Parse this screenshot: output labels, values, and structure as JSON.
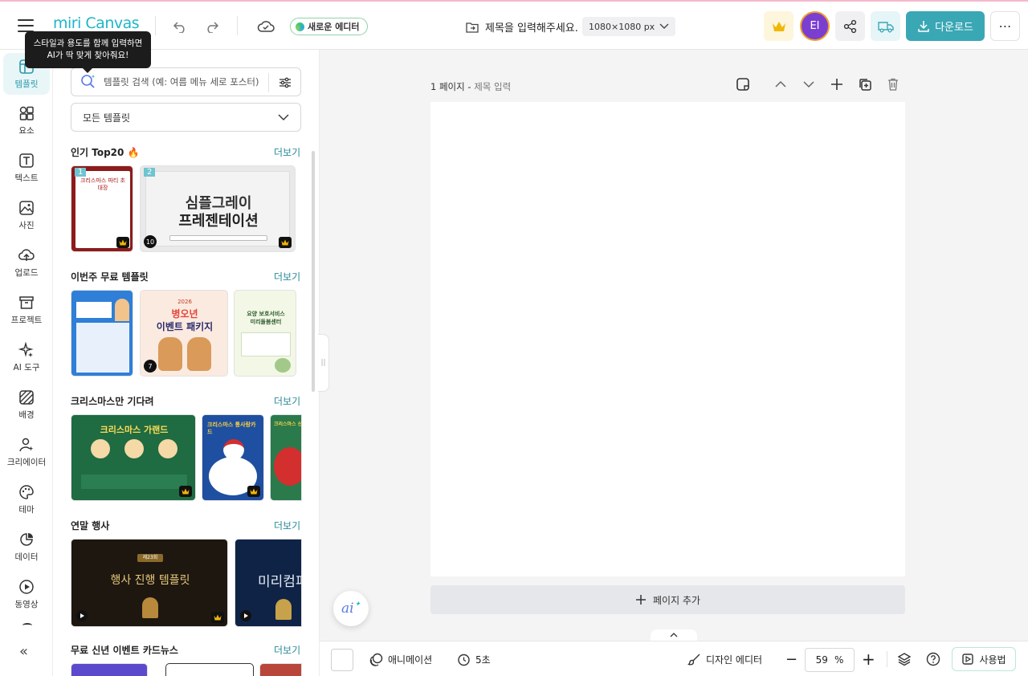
{
  "header": {
    "logo": "miri Canvas",
    "new_editor": "새로운 에디터",
    "title_placeholder": "제목을 입력해주세요.",
    "size": "1080×1080 px",
    "avatar": "EI",
    "download": "다운로드"
  },
  "tooltip": {
    "line1": "스타일과 용도를 함께 입력하면",
    "line2": "AI가 딱 맞게 찾아줘요!"
  },
  "rail": [
    {
      "label": "템플릿",
      "icon": "template-icon"
    },
    {
      "label": "요소",
      "icon": "elements-icon"
    },
    {
      "label": "텍스트",
      "icon": "text-icon"
    },
    {
      "label": "사진",
      "icon": "photo-icon"
    },
    {
      "label": "업로드",
      "icon": "upload-icon"
    },
    {
      "label": "프로젝트",
      "icon": "project-icon"
    },
    {
      "label": "AI 도구",
      "icon": "ai-tools-icon"
    },
    {
      "label": "배경",
      "icon": "background-icon"
    },
    {
      "label": "크리에이터",
      "icon": "creator-icon"
    },
    {
      "label": "테마",
      "icon": "theme-icon"
    },
    {
      "label": "데이터",
      "icon": "data-icon"
    },
    {
      "label": "동영상",
      "icon": "video-icon"
    }
  ],
  "panel": {
    "search_placeholder": "템플릿 검색 (예: 여름 메뉴 세로 포스터)",
    "category": "모든 템플릿",
    "more": "더보기",
    "sections": [
      {
        "title": "인기 Top20 🔥"
      },
      {
        "title": "이번주 무료 템플릿"
      },
      {
        "title": "크리스마스만 기다려"
      },
      {
        "title": "연말 행사"
      },
      {
        "title": "무료 신년 이벤트 카드뉴스"
      }
    ],
    "top20": {
      "badge1": "1",
      "badge2": "2",
      "count2": "10",
      "card1_title": "크리스마스 파티 초대장",
      "card2_line1": "심플그레이",
      "card2_line2": "프레젠테이션"
    },
    "free": {
      "card2_year": "2026",
      "card2_line1": "병오년",
      "card2_line2": "이벤트 패키지",
      "card2_count": "7",
      "card3_line1": "요양 보호서비스",
      "card3_line2": "미리돌봄센터"
    },
    "xmas": {
      "card1_title": "크리스마스 가랜드",
      "card2_title": "크리스마스 통사랑카드",
      "card3_title": "크리스마스 산타카드"
    },
    "yearend": {
      "card1_badge": "제23회",
      "card1_title": "행사 진행 템플릿",
      "card2_title": "미리컴퍼"
    }
  },
  "canvas": {
    "page_label": "1 페이지 -",
    "page_title_placeholder": "제목 입력",
    "add_page": "페이지 추가"
  },
  "bottombar": {
    "animation": "애니메이션",
    "duration": "5초",
    "design_editor": "디자인 에디터",
    "zoom_value": "59",
    "zoom_unit": "%",
    "guide": "사용법"
  }
}
